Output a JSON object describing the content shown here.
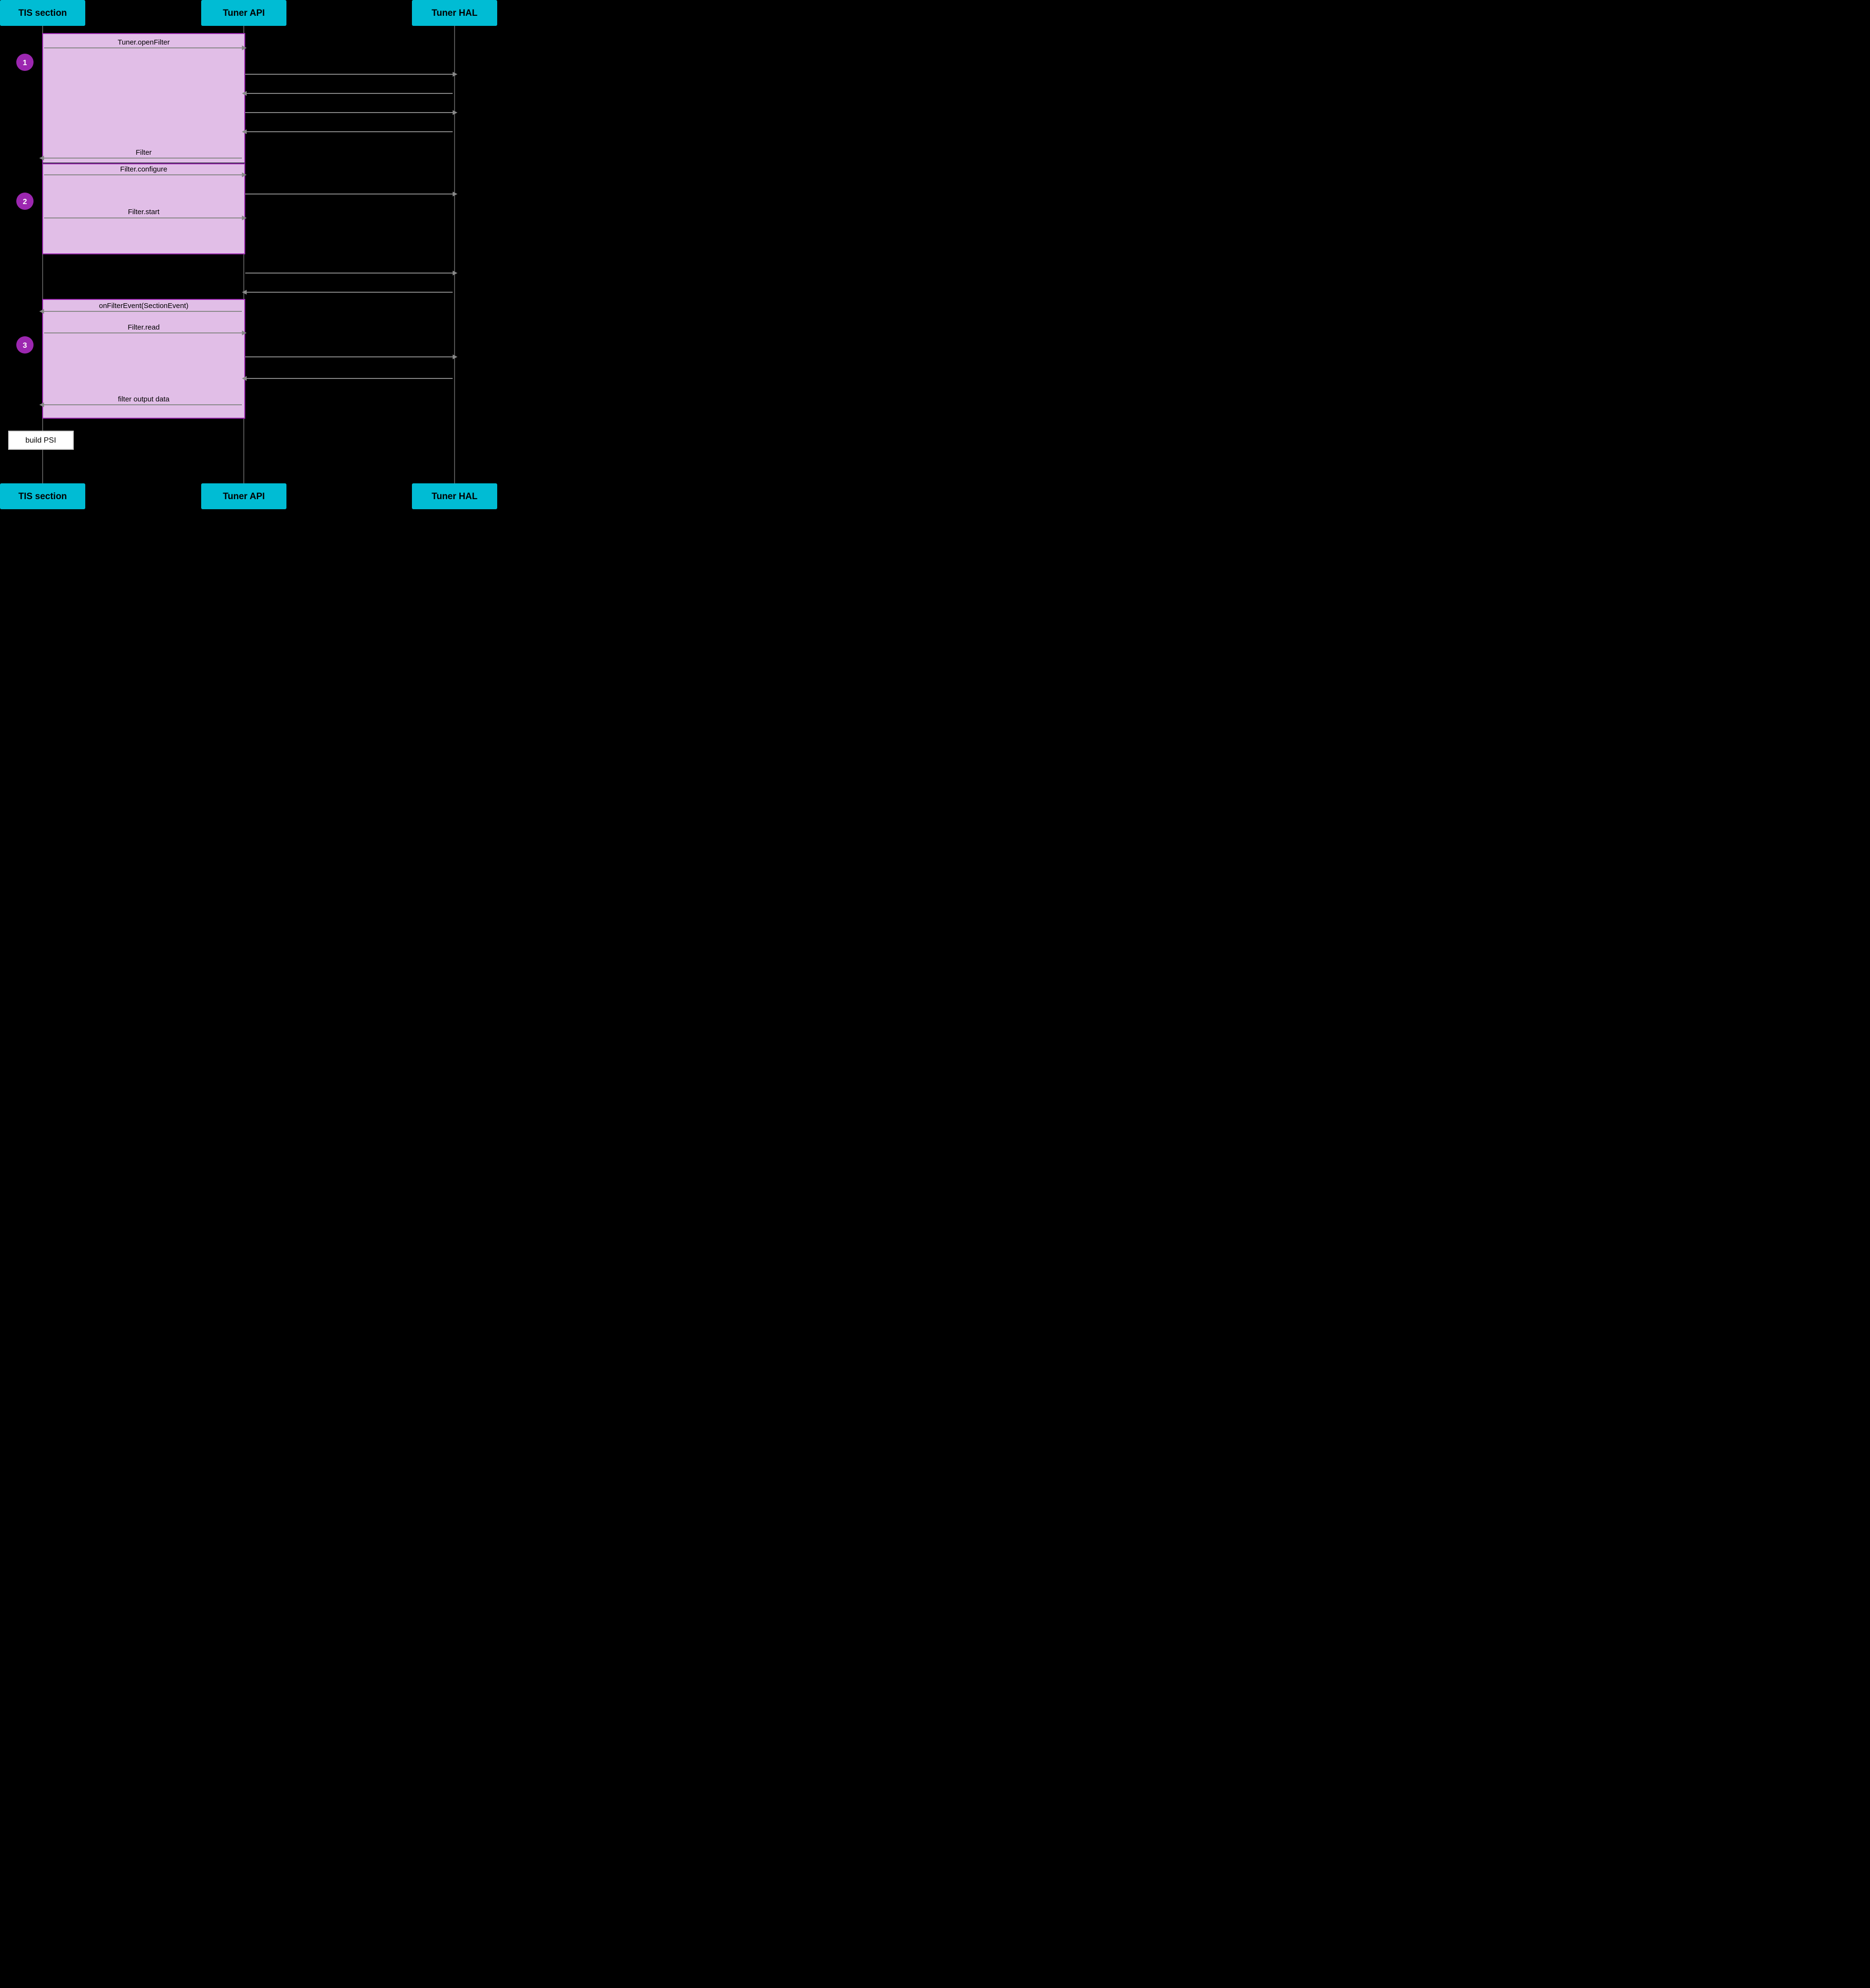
{
  "header": {
    "tis_label": "TIS section",
    "api_label": "Tuner API",
    "hal_label": "Tuner HAL"
  },
  "footer": {
    "tis_label": "TIS section",
    "api_label": "Tuner API",
    "hal_label": "Tuner HAL"
  },
  "steps": [
    {
      "id": "1",
      "label": "1"
    },
    {
      "id": "2",
      "label": "2"
    },
    {
      "id": "3",
      "label": "3"
    }
  ],
  "arrows": [
    {
      "id": "tuner-open-filter",
      "label": "Tuner.openFilter",
      "direction": "right"
    },
    {
      "id": "hal-call-1",
      "label": "",
      "direction": "right"
    },
    {
      "id": "hal-return-1",
      "label": "",
      "direction": "left"
    },
    {
      "id": "hal-call-2",
      "label": "",
      "direction": "right"
    },
    {
      "id": "hal-return-2",
      "label": "",
      "direction": "left"
    },
    {
      "id": "filter-return",
      "label": "Filter",
      "direction": "left"
    },
    {
      "id": "filter-configure",
      "label": "Filter.configure",
      "direction": "right"
    },
    {
      "id": "hal-call-3",
      "label": "",
      "direction": "right"
    },
    {
      "id": "filter-start",
      "label": "Filter.start",
      "direction": "right"
    },
    {
      "id": "hal-call-4",
      "label": "",
      "direction": "right"
    },
    {
      "id": "hal-return-3",
      "label": "",
      "direction": "left"
    },
    {
      "id": "on-filter-event",
      "label": "onFilterEvent(SectionEvent)",
      "direction": "left"
    },
    {
      "id": "filter-read",
      "label": "Filter.read",
      "direction": "right"
    },
    {
      "id": "hal-call-5",
      "label": "",
      "direction": "right"
    },
    {
      "id": "hal-return-4",
      "label": "",
      "direction": "left"
    },
    {
      "id": "filter-output",
      "label": "filter output data",
      "direction": "left"
    }
  ],
  "note": {
    "label": "build PSI"
  },
  "colors": {
    "header_bg": "#00BCD4",
    "section_bg": "#E1BEE7",
    "section_border": "#9C27B0",
    "step_circle": "#9C27B0",
    "arrow_color": "#888888",
    "black": "#000000",
    "white": "#ffffff"
  }
}
